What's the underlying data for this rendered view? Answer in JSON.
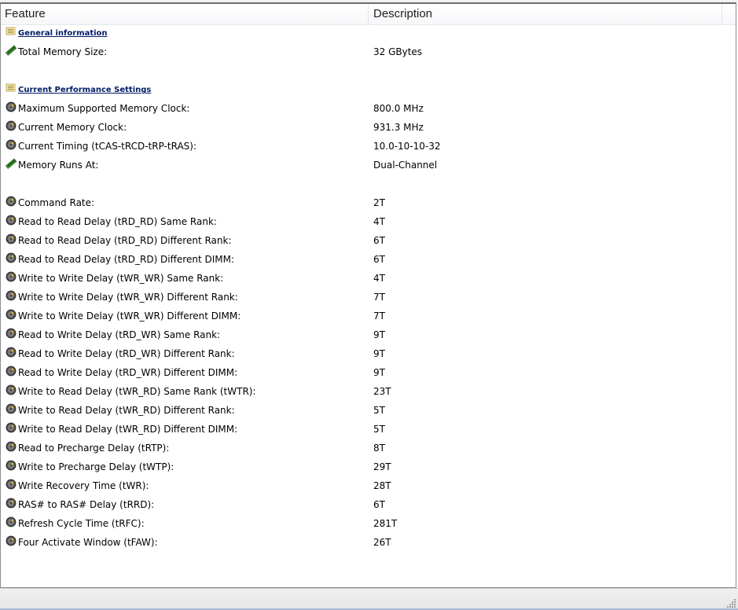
{
  "header": {
    "feature": "Feature",
    "description": "Description"
  },
  "rows": [
    {
      "type": "section",
      "icon": "notes-icon",
      "label": "General information",
      "value": ""
    },
    {
      "type": "item",
      "icon": "memory-module-icon",
      "label": "Total Memory Size:",
      "value": "32 GBytes"
    },
    {
      "type": "blank"
    },
    {
      "type": "section",
      "icon": "notes-icon",
      "label": "Current Performance Settings",
      "value": ""
    },
    {
      "type": "item",
      "icon": "gauge-icon",
      "label": "Maximum Supported Memory Clock:",
      "value": "800.0 MHz"
    },
    {
      "type": "item",
      "icon": "gauge-icon",
      "label": "Current Memory Clock:",
      "value": "931.3 MHz"
    },
    {
      "type": "item",
      "icon": "gauge-icon",
      "label": "Current Timing (tCAS-tRCD-tRP-tRAS):",
      "value": "10.0-10-10-32"
    },
    {
      "type": "item",
      "icon": "memory-module-icon",
      "label": "Memory Runs At:",
      "value": "Dual-Channel"
    },
    {
      "type": "blank"
    },
    {
      "type": "item",
      "icon": "gauge-icon",
      "label": "Command Rate:",
      "value": "2T"
    },
    {
      "type": "item",
      "icon": "gauge-icon",
      "label": "Read to Read Delay (tRD_RD) Same Rank:",
      "value": "4T"
    },
    {
      "type": "item",
      "icon": "gauge-icon",
      "label": "Read to Read Delay (tRD_RD) Different Rank:",
      "value": "6T"
    },
    {
      "type": "item",
      "icon": "gauge-icon",
      "label": "Read to Read Delay (tRD_RD) Different DIMM:",
      "value": "6T"
    },
    {
      "type": "item",
      "icon": "gauge-icon",
      "label": "Write to Write Delay (tWR_WR) Same Rank:",
      "value": "4T"
    },
    {
      "type": "item",
      "icon": "gauge-icon",
      "label": "Write to Write Delay (tWR_WR) Different Rank:",
      "value": "7T"
    },
    {
      "type": "item",
      "icon": "gauge-icon",
      "label": "Write to Write Delay (tWR_WR) Different DIMM:",
      "value": "7T"
    },
    {
      "type": "item",
      "icon": "gauge-icon",
      "label": "Read to Write Delay (tRD_WR) Same Rank:",
      "value": "9T"
    },
    {
      "type": "item",
      "icon": "gauge-icon",
      "label": "Read to Write Delay (tRD_WR) Different Rank:",
      "value": "9T"
    },
    {
      "type": "item",
      "icon": "gauge-icon",
      "label": "Read to Write Delay (tRD_WR) Different DIMM:",
      "value": "9T"
    },
    {
      "type": "item",
      "icon": "gauge-icon",
      "label": "Write to Read Delay (tWR_RD) Same Rank (tWTR):",
      "value": "23T"
    },
    {
      "type": "item",
      "icon": "gauge-icon",
      "label": "Write to Read Delay (tWR_RD) Different Rank:",
      "value": "5T"
    },
    {
      "type": "item",
      "icon": "gauge-icon",
      "label": "Write to Read Delay (tWR_RD) Different DIMM:",
      "value": "5T"
    },
    {
      "type": "item",
      "icon": "gauge-icon",
      "label": "Read to Precharge Delay (tRTP):",
      "value": "8T"
    },
    {
      "type": "item",
      "icon": "gauge-icon",
      "label": "Write to Precharge Delay (tWTP):",
      "value": "29T"
    },
    {
      "type": "item",
      "icon": "gauge-icon",
      "label": "Write Recovery Time (tWR):",
      "value": "28T"
    },
    {
      "type": "item",
      "icon": "gauge-icon",
      "label": "RAS# to RAS# Delay (tRRD):",
      "value": "6T"
    },
    {
      "type": "item",
      "icon": "gauge-icon",
      "label": "Refresh Cycle Time (tRFC):",
      "value": "281T"
    },
    {
      "type": "item",
      "icon": "gauge-icon",
      "label": "Four Activate Window (tFAW):",
      "value": "26T"
    }
  ]
}
